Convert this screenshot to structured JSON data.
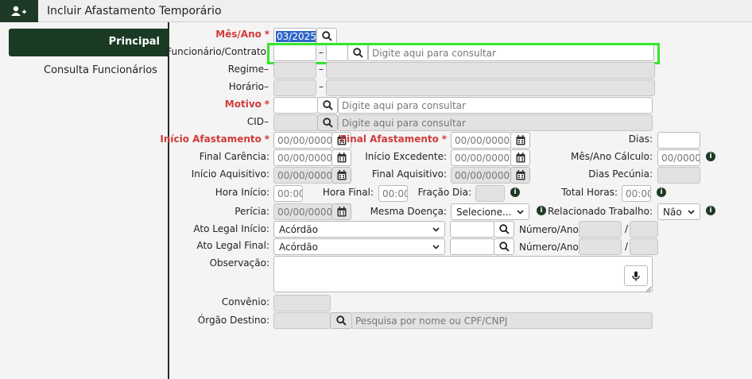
{
  "window": {
    "title": "Incluir Afastamento Temporário"
  },
  "tabs": [
    {
      "label": "Principal"
    },
    {
      "label": "Consulta Funcionários"
    }
  ],
  "form": {
    "mes_ano": {
      "label": "Mês/Ano",
      "value": "03/2025"
    },
    "funcionario": {
      "label": "Funcionário/Contrato",
      "placeholder": "Digite aqui para consultar"
    },
    "regime": {
      "label": "Regime"
    },
    "horario": {
      "label": "Horário"
    },
    "motivo": {
      "label": "Motivo",
      "placeholder": "Digite aqui para consultar"
    },
    "cid": {
      "label": "CID",
      "placeholder": "Digite aqui para consultar"
    },
    "inicio_afastamento": {
      "label": "Início Afastamento",
      "placeholder": "00/00/0000"
    },
    "final_afastamento": {
      "label": "Final Afastamento",
      "placeholder": "00/00/0000"
    },
    "dias": {
      "label": "Dias:"
    },
    "final_carencia": {
      "label": "Final Carência:",
      "placeholder": "00/00/0000"
    },
    "inicio_excedente": {
      "label": "Início Excedente:",
      "placeholder": "00/00/0000"
    },
    "mes_ano_calculo": {
      "label": "Mês/Ano Cálculo:",
      "placeholder": "00/0000"
    },
    "inicio_aquisitivo": {
      "label": "Início Aquisitivo:",
      "placeholder": "00/00/0000"
    },
    "final_aquisitivo": {
      "label": "Final Aquisitivo:",
      "placeholder": "00/00/0000"
    },
    "dias_pecunia": {
      "label": "Dias Pecúnia:"
    },
    "hora_inicio": {
      "label": "Hora Início:",
      "placeholder": "00:00"
    },
    "hora_final": {
      "label": "Hora Final:",
      "placeholder": "00:00"
    },
    "fracao_dia": {
      "label": "Fração Dia:"
    },
    "total_horas": {
      "label": "Total Horas:",
      "placeholder": "00:00"
    },
    "pericia": {
      "label": "Perícia:",
      "placeholder": "00/00/0000"
    },
    "mesma_doenca": {
      "label": "Mesma Doença:",
      "value": "Selecione..."
    },
    "relacionado_trabalho": {
      "label": "Relacionado Trabalho:",
      "value": "Não"
    },
    "ato_legal_inicio": {
      "label": "Ato Legal Início:",
      "value": "Acórdão",
      "numero_label": "Número/Ano:"
    },
    "ato_legal_final": {
      "label": "Ato Legal Final:",
      "value": "Acórdão",
      "numero_label": "Número/Ano:"
    },
    "observacao": {
      "label": "Observação:"
    },
    "convenio": {
      "label": "Convênio:"
    },
    "orgao_destino": {
      "label": "Órgão Destino:",
      "placeholder": "Pesquisa por nome ou CPF/CNPJ"
    }
  },
  "symbols": {
    "required": "*",
    "dash": "–",
    "slash": "/",
    "info": "i"
  },
  "colors": {
    "brand": "#1b3a24",
    "required": "#d23a3a",
    "highlight": "#34e62b"
  }
}
